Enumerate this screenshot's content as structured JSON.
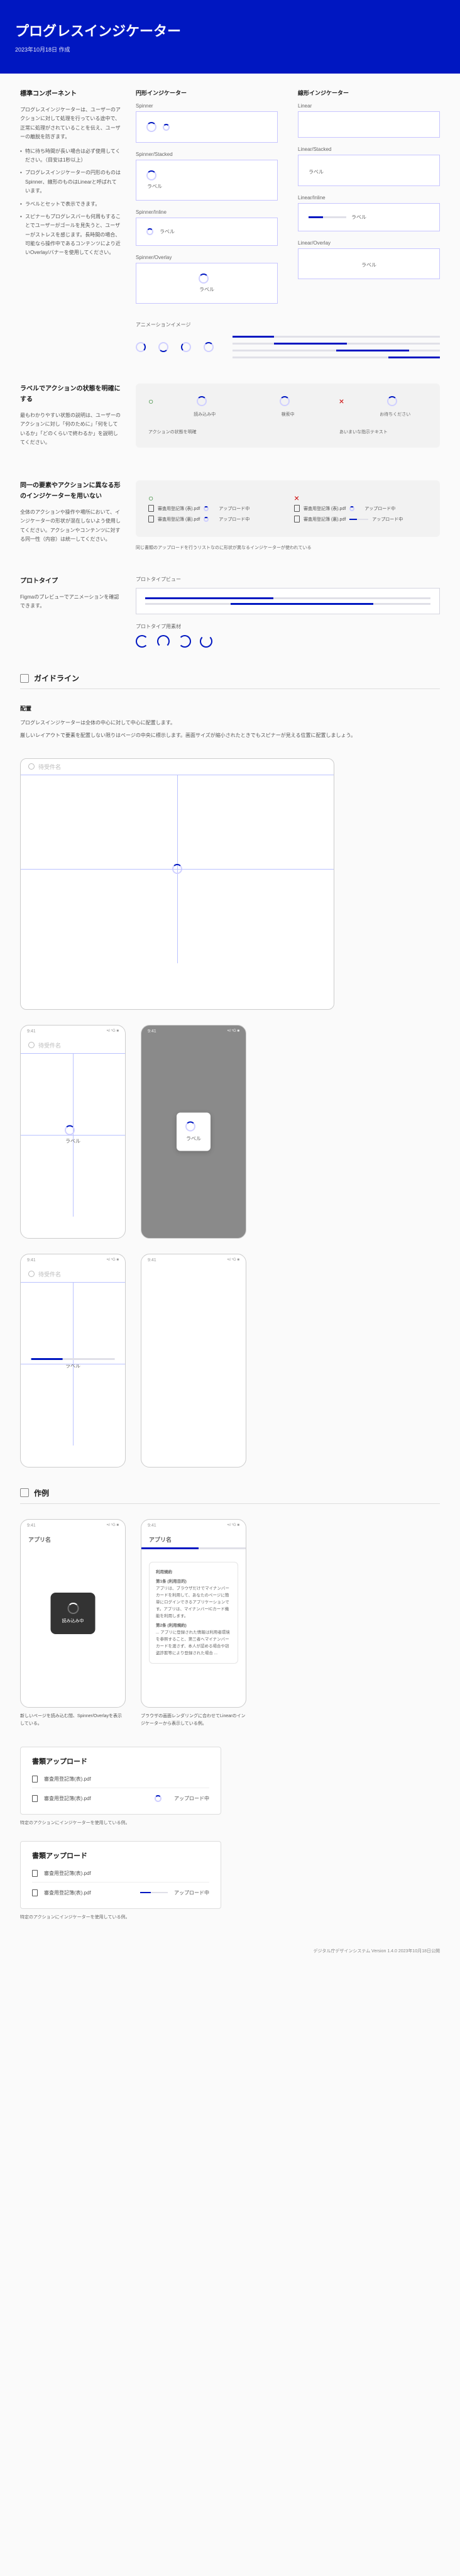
{
  "hero": {
    "title": "プログレスインジケーター",
    "date": "2023年10月18日 作成"
  },
  "standard": {
    "heading": "標準コンポーネント",
    "desc": "プログレスインジケーターは、ユーザーのアクションに対して処理を行っている途中で、正常に処理がされていることを伝え、ユーザーの離脱を防ぎます。",
    "bullets": [
      "特に待ち時間が長い場合は必ず使用してください。（目安は1秒以上）",
      "プログレスインジケーターの円形のものはSpinner、線形のものはLinearと呼ばれています。",
      "ラベルとセットで表示できます。",
      "スピナーもプログレスバーも何周もすることでユーザーがゴールを見失うと、ユーザーがストレスを感じます。長時間の場合、可能なら操作中であるコンテンツにより近いOverlay/バナーを使用してください。"
    ]
  },
  "variants": {
    "col1": {
      "h": "円形インジケーター",
      "items": [
        "Spinner",
        "Spinner/Stacked",
        "Spinner/Inline",
        "Spinner/Overlay"
      ]
    },
    "col2": {
      "h": "線形インジケーター",
      "items": [
        "Linear",
        "Linear/Stacked",
        "Linear/Inline",
        "Linear/Overlay"
      ]
    },
    "label": "ラベル",
    "anim": "アニメーションイメージ"
  },
  "rule1": {
    "h": "ラベルでアクションの状態を明確にする",
    "p": "最もわかりやすい状態の説明は、ユーザーのアクションに対し「何のために」「何をしているか」「どのくらいで終わるか」を説明してください。",
    "ok": [
      "読み込み中",
      "検索中"
    ],
    "ng": "お待ちください",
    "cap_ok": "アクションの状態を明確",
    "cap_ng": "あいまいな指示テキスト"
  },
  "rule2": {
    "h": "同一の要素やアクションに異なる形のインジケーターを用いない",
    "p": "全体のアクションや操作や場所において、インジケーターの形状が混在しないよう使用してください。アクションやコンテンツに対する同一性（内容）は統一してください。",
    "cap": "同じ書類のアップロードを行うリストなのに形状が異なるインジケーターが使われている",
    "files": {
      "a": "審査用登記簿 (表).pdf",
      "b": "審査用登記簿 (裏).pdf",
      "status": "アップロード中"
    }
  },
  "proto": {
    "h": "プロトタイプ",
    "p": "Figmaのプレビューでアニメーションを確認できます。",
    "t1": "プロトタイプビュー",
    "t2": "プロトタイプ用素材"
  },
  "guidelines": {
    "h": "ガイドライン"
  },
  "placement": {
    "h": "配置",
    "p1": "プログレスインジケーターは全体の中心に対して中心に配置します。",
    "p2": "厳しいレイアウトで要素を配置しない限りはページの中央に標示します。画面サイズが縮小されたときでもスピナーが見える位置に配置しましょう。",
    "holder_title": "待受件名",
    "center_label": "ラベル"
  },
  "examples": {
    "h": "作例"
  },
  "usecase": {
    "time": "9:41",
    "signal": "•ıl ⁵G ■",
    "app": "アプリ名",
    "tos_title": "利用規約",
    "tos_sub": "第1条 (利用目的)",
    "tos_body": "アプリは、ブラウザだけでマイナンバーカードを利用して、あなたのページに簡単にログインできるアプリケーションです。アプリは、マイナンバーICカード機能を利用します。",
    "tos_art2": "第2条 (利用規約)",
    "tos_body2": "... アプリに登録された情報は利用者環境を参照すること、第三者へマイナンバーカードを渡さず、本人が認める場合や窃盗詐欺等により登録された場合 ...",
    "loading": "読み込み中",
    "cap1": "新しいページを読み込む間、Spinner/Overlayを表示している。",
    "cap2": "ブラウザの画面レンダリングに合わせてLinearのインジケーターから表示している例。"
  },
  "upload": {
    "title": "書類アップロード",
    "file": "審査用登記簿(表).pdf",
    "status": "アップロード中",
    "cap1": "特定のアクションにインジケーターを使用している例。",
    "cap2": "特定のアクションにインジケーターを使用している例。"
  },
  "footer": "デジタル庁デザインシステム Version 1.4.0 2023年10月18日公開"
}
